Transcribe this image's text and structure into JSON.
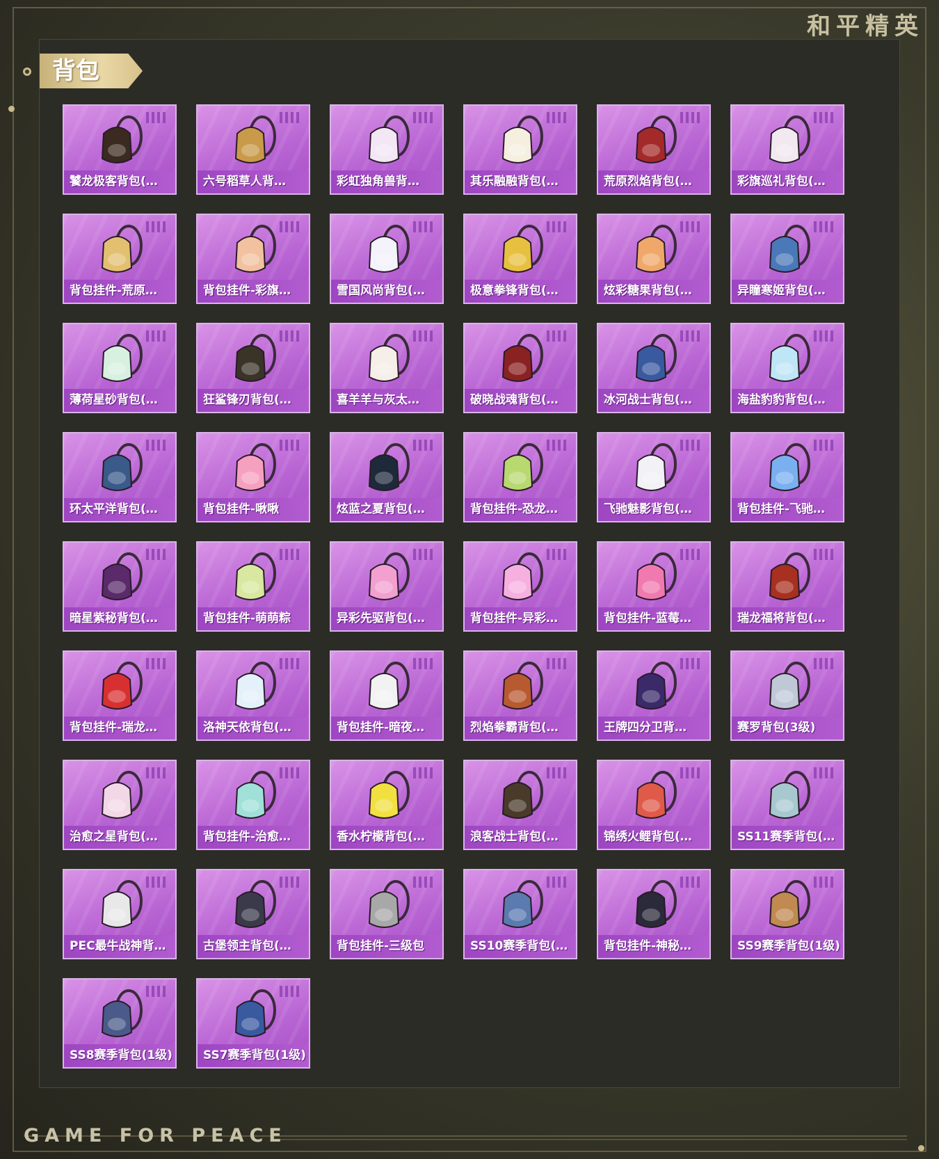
{
  "brand": "和平精英",
  "section_title": "背包",
  "footer": "GAME FOR PEACE",
  "items": [
    {
      "label": "饕龙极客背包(…",
      "icon": "dragon-backpack-icon",
      "color": "#3a2a20"
    },
    {
      "label": "六号稻草人背…",
      "icon": "scarecrow-backpack-icon",
      "color": "#c89a4a"
    },
    {
      "label": "彩虹独角兽背…",
      "icon": "unicorn-backpack-icon",
      "color": "#f3e6f5"
    },
    {
      "label": "其乐融融背包(…",
      "icon": "bunny-backpack-icon",
      "color": "#f6efe0"
    },
    {
      "label": "荒原烈焰背包(…",
      "icon": "flame-backpack-icon",
      "color": "#a42a2a"
    },
    {
      "label": "彩旗巡礼背包(…",
      "icon": "flag-backpack-icon",
      "color": "#f1e8f0"
    },
    {
      "label": "背包挂件-荒原…",
      "icon": "charm-icon",
      "color": "#e3c070"
    },
    {
      "label": "背包挂件-彩旗…",
      "icon": "icecream-charm-icon",
      "color": "#f2c2a0"
    },
    {
      "label": "雪国风尚背包(…",
      "icon": "snow-backpack-icon",
      "color": "#f4f2fa"
    },
    {
      "label": "极意拳锋背包(…",
      "icon": "fist-backpack-icon",
      "color": "#e8c040"
    },
    {
      "label": "炫彩糖果背包(…",
      "icon": "donut-backpack-icon",
      "color": "#f0a86a"
    },
    {
      "label": "异瞳寒姬背包(…",
      "icon": "ice-backpack-icon",
      "color": "#4a78b8"
    },
    {
      "label": "薄荷星砂背包(…",
      "icon": "mint-bag-icon",
      "color": "#d8f0e0"
    },
    {
      "label": "狂鲨锋刃背包(…",
      "icon": "shark-backpack-icon",
      "color": "#3a3428"
    },
    {
      "label": "喜羊羊与灰太…",
      "icon": "sheep-backpack-icon",
      "color": "#f6eee8"
    },
    {
      "label": "破晓战魂背包(…",
      "icon": "war-backpack-icon",
      "color": "#8a2222"
    },
    {
      "label": "冰河战士背包(…",
      "icon": "glacier-backpack-icon",
      "color": "#3a5aa0"
    },
    {
      "label": "海盐豹豹背包(…",
      "icon": "seal-backpack-icon",
      "color": "#bfe6f6"
    },
    {
      "label": "环太平洋背包(…",
      "icon": "mech-backpack-icon",
      "color": "#3a5a8a"
    },
    {
      "label": "背包挂件-啾啾",
      "icon": "pink-pet-charm-icon",
      "color": "#f6a0c0"
    },
    {
      "label": "炫蓝之夏背包(…",
      "icon": "blue-summer-backpack-icon",
      "color": "#1e2a3a"
    },
    {
      "label": "背包挂件-恐龙…",
      "icon": "dino-egg-charm-icon",
      "color": "#b8d870"
    },
    {
      "label": "飞驰魅影背包(…",
      "icon": "racer-backpack-icon",
      "color": "#f2f2f6"
    },
    {
      "label": "背包挂件-飞驰…",
      "icon": "wing-charm-icon",
      "color": "#7ab0f0"
    },
    {
      "label": "暗星紫秘背包(…",
      "icon": "dark-star-backpack-icon",
      "color": "#5a2a6a"
    },
    {
      "label": "背包挂件-萌萌粽",
      "icon": "zongzi-charm-icon",
      "color": "#d8e8a0"
    },
    {
      "label": "异彩先驱背包(…",
      "icon": "pioneer-backpack-icon",
      "color": "#f2a0d0"
    },
    {
      "label": "背包挂件-异彩…",
      "icon": "skate-charm-icon",
      "color": "#f6b0e0"
    },
    {
      "label": "背包挂件-蓝莓…",
      "icon": "blueberry-cone-charm-icon",
      "color": "#f07ab0"
    },
    {
      "label": "瑞龙福将背包(…",
      "icon": "fortune-dragon-backpack-icon",
      "color": "#a83020"
    },
    {
      "label": "背包挂件-瑞龙…",
      "icon": "lucky-charm-icon",
      "color": "#d83030"
    },
    {
      "label": "洛神天依背包(…",
      "icon": "luo-backpack-icon",
      "color": "#e4f0fa"
    },
    {
      "label": "背包挂件-暗夜…",
      "icon": "rabbit-charm-icon",
      "color": "#f2f2f2"
    },
    {
      "label": "烈焰拳霸背包(…",
      "icon": "fire-fist-backpack-icon",
      "color": "#b85a30"
    },
    {
      "label": "王牌四分卫背…",
      "icon": "quarterback-backpack-icon",
      "color": "#3a2a6a"
    },
    {
      "label": "赛罗背包(3级)",
      "icon": "zero-backpack-icon",
      "color": "#c0c8d8"
    },
    {
      "label": "治愈之星背包(…",
      "icon": "healing-star-backpack-icon",
      "color": "#f2d8e6"
    },
    {
      "label": "背包挂件-治愈…",
      "icon": "bottle-charm-icon",
      "color": "#a0e0d8"
    },
    {
      "label": "香水柠檬背包(…",
      "icon": "lemon-backpack-icon",
      "color": "#f2e040"
    },
    {
      "label": "浪客战士背包(…",
      "icon": "ronin-backpack-icon",
      "color": "#4a3a2a"
    },
    {
      "label": "锦绣火鲤背包(…",
      "icon": "koi-backpack-icon",
      "color": "#e05a4a"
    },
    {
      "label": "SS11赛季背包(…",
      "icon": "ss11-backpack-icon",
      "color": "#a8c8d0"
    },
    {
      "label": "PEC最牛战神背…",
      "icon": "guitar-backpack-icon",
      "color": "#e8e8e8"
    },
    {
      "label": "古堡领主背包(…",
      "icon": "castle-backpack-icon",
      "color": "#3a3a4a"
    },
    {
      "label": "背包挂件-三级包",
      "icon": "level3-charm-icon",
      "color": "#a8a8a8"
    },
    {
      "label": "SS10赛季背包(…",
      "icon": "ss10-backpack-icon",
      "color": "#5a7ab0"
    },
    {
      "label": "背包挂件-神秘…",
      "icon": "cat-charm-icon",
      "color": "#2a2a3a"
    },
    {
      "label": "SS9赛季背包(1级)",
      "icon": "ss9-backpack-icon",
      "color": "#c08a50"
    },
    {
      "label": "SS8赛季背包(1级)",
      "icon": "ss8-backpack-icon",
      "color": "#4a5a8a"
    },
    {
      "label": "SS7赛季背包(1级)",
      "icon": "ss7-backpack-icon",
      "color": "#3a5aa0"
    }
  ]
}
